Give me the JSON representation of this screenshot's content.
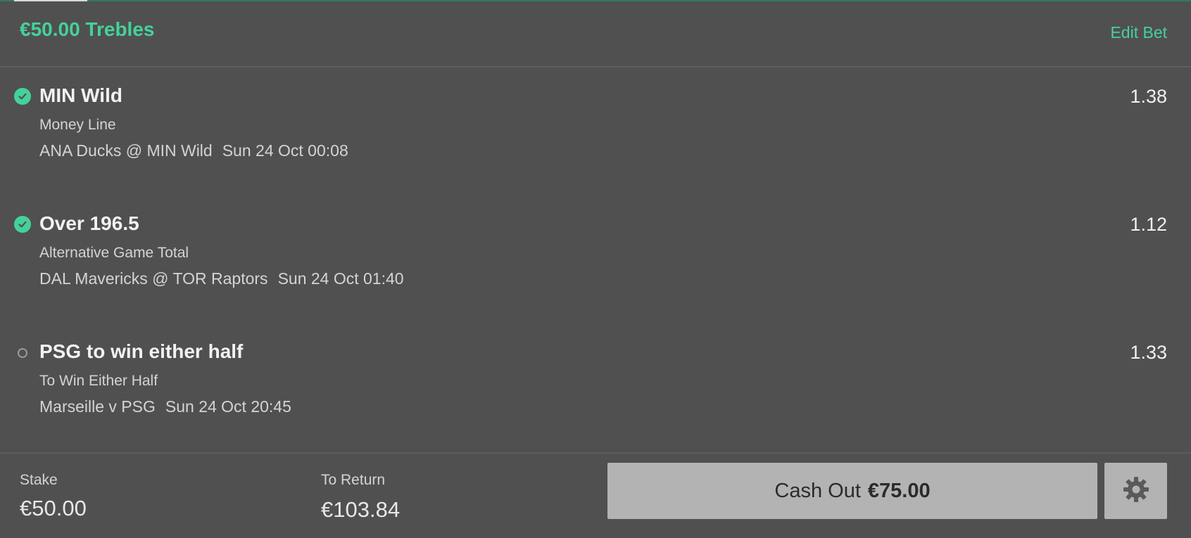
{
  "header": {
    "title": "€50.00 Trebles",
    "edit_label": "Edit Bet"
  },
  "selections": [
    {
      "status": "won",
      "status_icon": "check-circle-icon",
      "name": "MIN Wild",
      "market": "Money Line",
      "event": "ANA Ducks @ MIN Wild",
      "time": "Sun 24 Oct 00:08",
      "odds": "1.38"
    },
    {
      "status": "won",
      "status_icon": "check-circle-icon",
      "name": "Over 196.5",
      "market": "Alternative Game Total",
      "event": "DAL Mavericks @ TOR Raptors",
      "time": "Sun 24 Oct 01:40",
      "odds": "1.12"
    },
    {
      "status": "pending",
      "status_icon": "empty-circle-icon",
      "name": "PSG to win either half",
      "market": "To Win Either Half",
      "event": "Marseille v PSG",
      "time": "Sun 24 Oct 20:45",
      "odds": "1.33"
    }
  ],
  "footer": {
    "stake_label": "Stake",
    "stake_value": "€50.00",
    "return_label": "To Return",
    "return_value": "€103.84",
    "cashout_label": "Cash Out",
    "cashout_amount": "€75.00",
    "settings_icon": "gear-icon"
  },
  "colors": {
    "accent": "#45d19b",
    "background": "#505050",
    "button": "#b3b3b3"
  }
}
